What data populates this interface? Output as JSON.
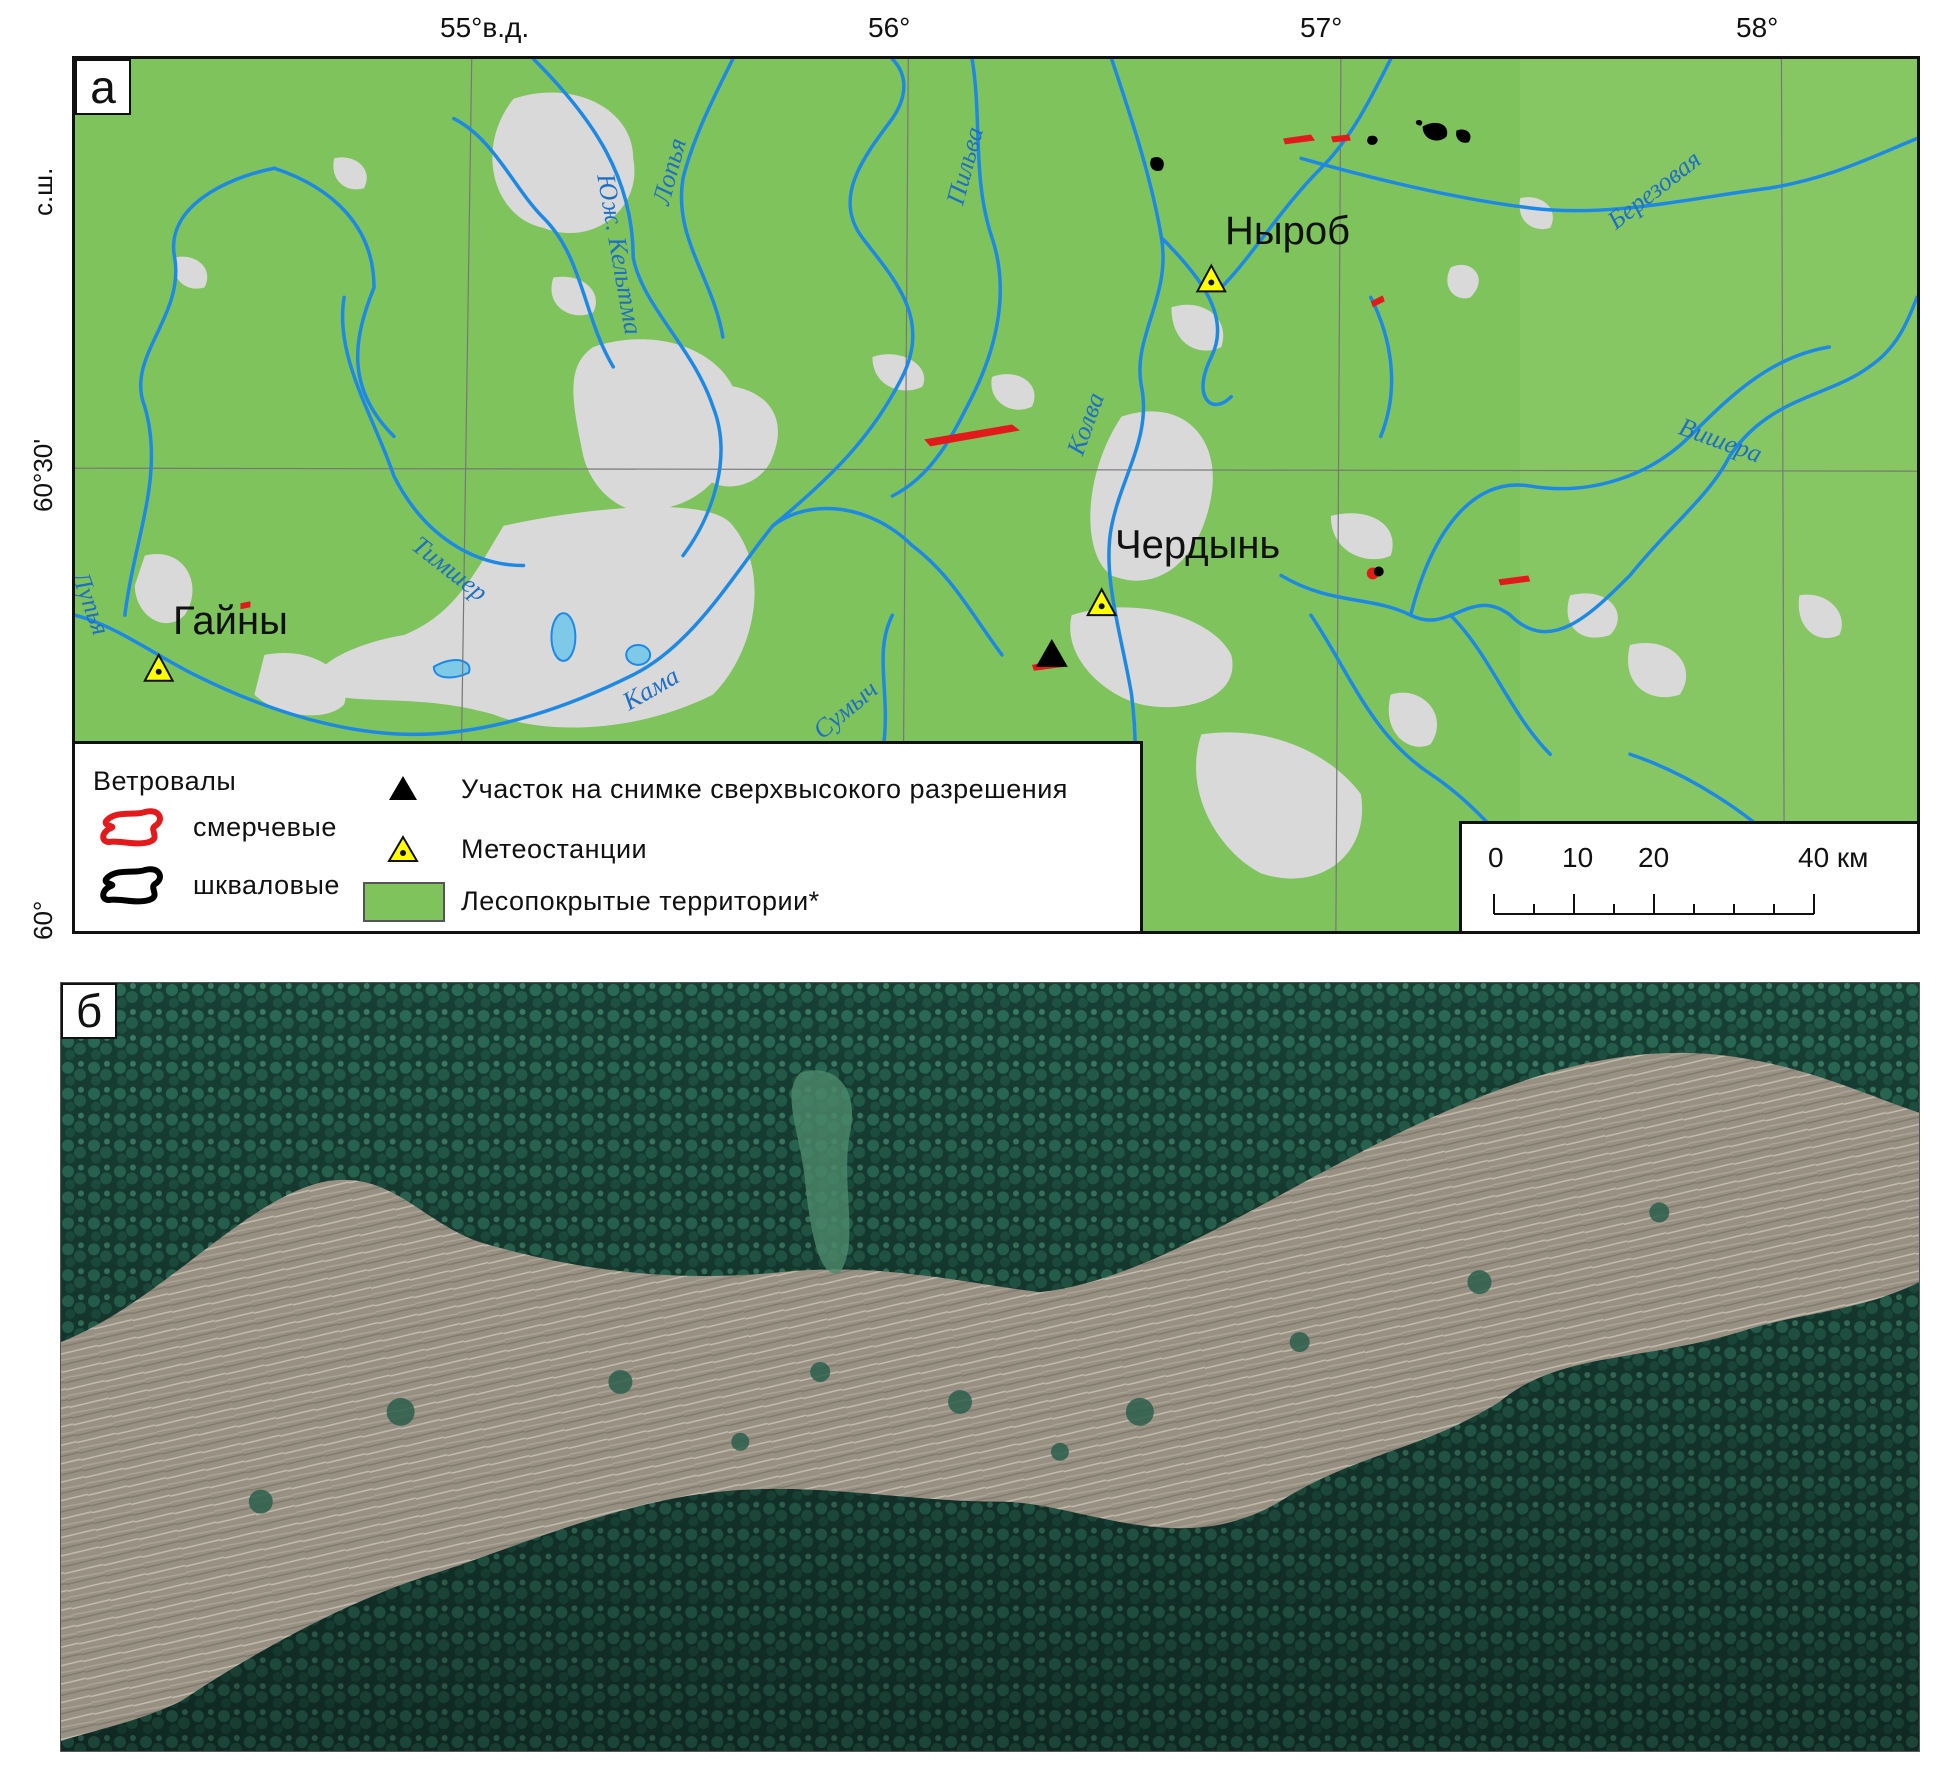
{
  "panel_a": {
    "letter": "а",
    "coordinates": {
      "top": [
        "55°в.д.",
        "56°",
        "57°",
        "58°"
      ],
      "left": [
        "с.ш.",
        "60°30'",
        "60°"
      ]
    },
    "settlements": [
      "Ныроб",
      "Чердынь",
      "Гайны"
    ],
    "rivers": [
      "Лопья",
      "Юж. Кельтма",
      "Пильва",
      "Березовая",
      "Колва",
      "Вишера",
      "Тимшер",
      "Кама",
      "Сумыч",
      "Лупья"
    ],
    "legend": {
      "windfall_title": "Ветровалы",
      "tornado_label": "смерчевые",
      "squall_label": "шкваловые",
      "site_label": "Участок на снимке сверхвысокого разрешения",
      "station_label": "Метеостанции",
      "forest_label": "Лесопокрытые территории*"
    },
    "scale": {
      "labels": [
        "0",
        "10",
        "20",
        "40 км"
      ]
    },
    "colors": {
      "forest": "#7fc35d",
      "non_forest": "#d8d8d8",
      "river": "#1e88e5",
      "tornado_windfall": "#e31a1c",
      "squall_windfall": "#000000",
      "station": "#ffff00"
    }
  },
  "panel_b": {
    "letter": "б"
  }
}
